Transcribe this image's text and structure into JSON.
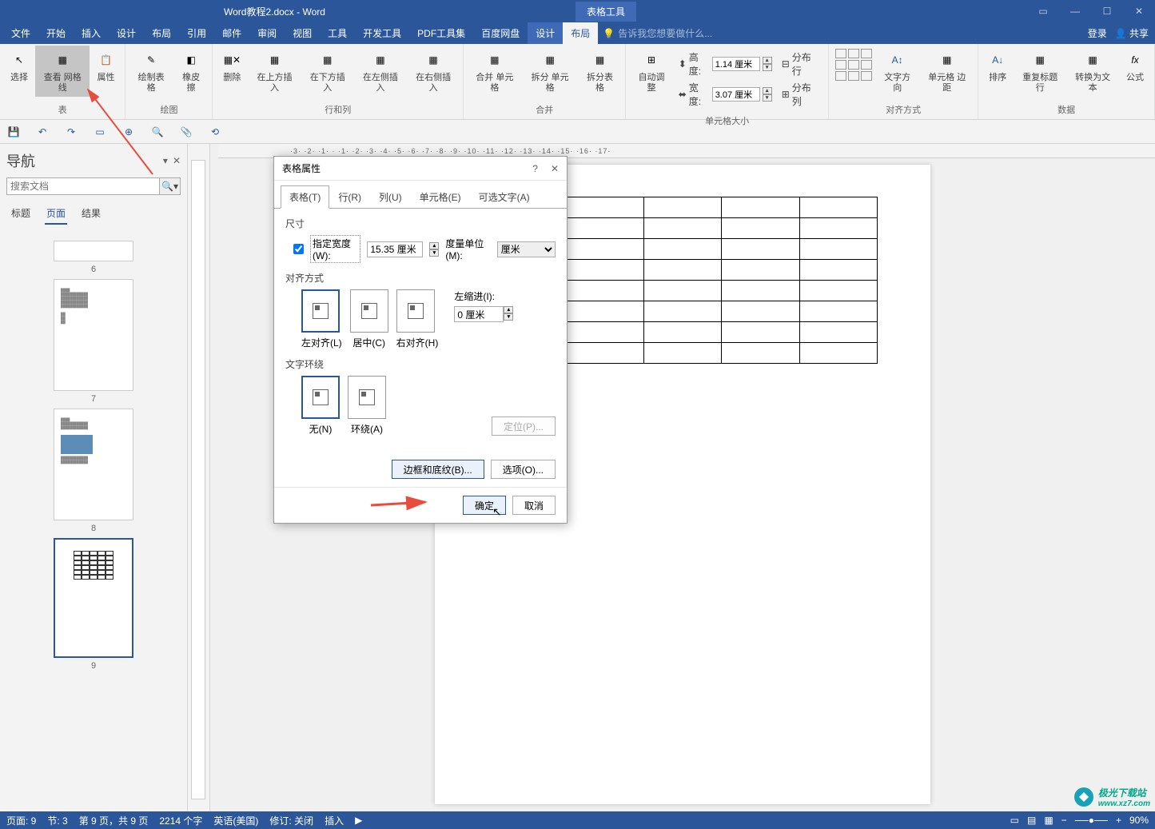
{
  "titlebar": {
    "doc": "Word教程2.docx - Word",
    "tool": "表格工具"
  },
  "menu": {
    "file": "文件",
    "start": "开始",
    "insert": "插入",
    "design": "设计",
    "layout": "布局",
    "ref": "引用",
    "mail": "邮件",
    "review": "审阅",
    "view": "视图",
    "tools": "工具",
    "dev": "开发工具",
    "pdf": "PDF工具集",
    "baidu": "百度网盘",
    "tdesign": "设计",
    "tlayout": "布局",
    "tell": "告诉我您想要做什么...",
    "login": "登录",
    "share": "共享"
  },
  "ribbon": {
    "g1": {
      "label": "表",
      "select": "选择",
      "grid": "查看\n网格线",
      "prop": "属性"
    },
    "g2": {
      "label": "绘图",
      "draw": "绘制表格",
      "eraser": "橡皮擦"
    },
    "g3": {
      "label": "行和列",
      "del": "删除",
      "above": "在上方插入",
      "below": "在下方插入",
      "left": "在左侧插入",
      "right": "在右侧插入"
    },
    "g4": {
      "label": "合并",
      "merge": "合并\n单元格",
      "split": "拆分\n单元格",
      "splitTbl": "拆分表格"
    },
    "g5": {
      "label": "单元格大小",
      "auto": "自动调整",
      "height": "高度:",
      "hval": "1.14 厘米",
      "width": "宽度:",
      "wval": "3.07 厘米",
      "distRow": "分布行",
      "distCol": "分布列"
    },
    "g6": {
      "label": "对齐方式",
      "dir": "文字方向",
      "margin": "单元格\n边距"
    },
    "g7": {
      "label": "数据",
      "sort": "排序",
      "repeat": "重复标题行",
      "convert": "转换为文本",
      "formula": "公式"
    }
  },
  "nav": {
    "title": "导航",
    "search": "搜索文档",
    "tab1": "标题",
    "tab2": "页面",
    "tab3": "结果",
    "p6": "6",
    "p7": "7",
    "p8": "8",
    "p9": "9"
  },
  "dialog": {
    "title": "表格属性",
    "tabs": {
      "table": "表格(T)",
      "row": "行(R)",
      "col": "列(U)",
      "cell": "单元格(E)",
      "alt": "可选文字(A)"
    },
    "size": "尺寸",
    "specWidth": "指定宽度(W):",
    "widthVal": "15.35 厘米",
    "unit": "度量单位(M):",
    "unitVal": "厘米",
    "align": "对齐方式",
    "left": "左对齐(L)",
    "center": "居中(C)",
    "right": "右对齐(H)",
    "indent": "左缩进(I):",
    "indentVal": "0 厘米",
    "wrap": "文字环绕",
    "none": "无(N)",
    "around": "环绕(A)",
    "position": "定位(P)...",
    "border": "边框和底纹(B)...",
    "options": "选项(O)...",
    "ok": "确定",
    "cancel": "取消"
  },
  "ruler": "·3· ·2· ·1· · ·1· ·2· ·3· ·4· ·5· ·6· ·7· ·8· ·9· ·10· ·11· ·12· ·13· ·14· ·15· ·16· ·17·",
  "status": {
    "page": "页面: 9",
    "sec": "节: 3",
    "pages": "第 9 页，共 9 页",
    "words": "2214 个字",
    "lang": "英语(美国)",
    "track": "修订: 关闭",
    "insert": "插入",
    "zoom": "90%"
  },
  "watermark": {
    "brand": "极光下载站",
    "url": "www.xz7.com"
  }
}
